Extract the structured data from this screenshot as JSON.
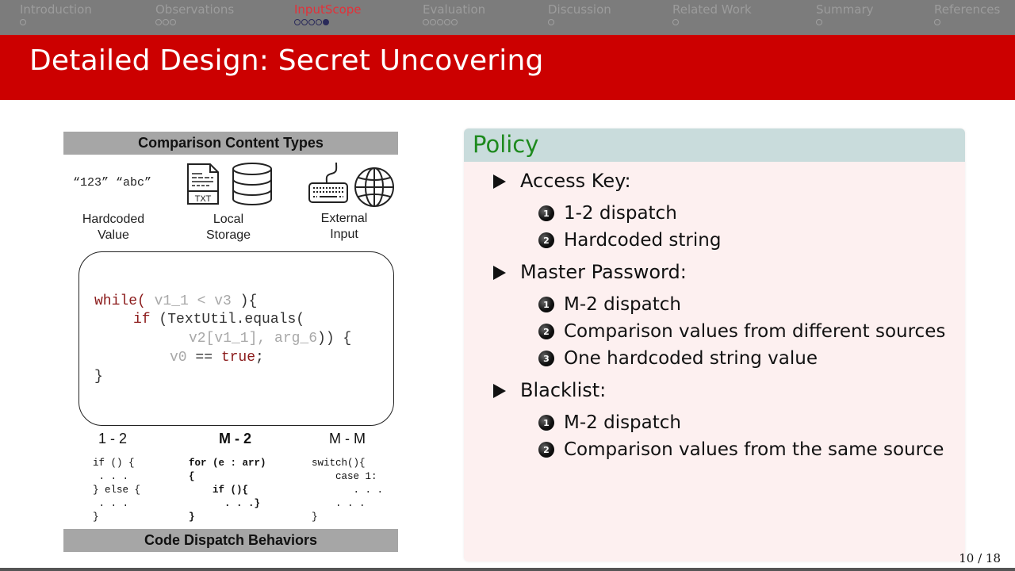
{
  "nav": {
    "sections": [
      {
        "label": "Introduction",
        "dots": 1,
        "filled": 0,
        "active": false
      },
      {
        "label": "Observations",
        "dots": 3,
        "filled": 0,
        "active": false
      },
      {
        "label": "InputScope",
        "dots": 5,
        "filled": 5,
        "active": true
      },
      {
        "label": "Evaluation",
        "dots": 5,
        "filled": 0,
        "active": false
      },
      {
        "label": "Discussion",
        "dots": 1,
        "filled": 0,
        "active": false
      },
      {
        "label": "Related Work",
        "dots": 1,
        "filled": 0,
        "active": false
      },
      {
        "label": "Summary",
        "dots": 1,
        "filled": 0,
        "active": false
      },
      {
        "label": "References",
        "dots": 1,
        "filled": 0,
        "active": false
      }
    ]
  },
  "slide": {
    "title": "Detailed Design: Secret Uncovering",
    "page": "10 / 18"
  },
  "figure": {
    "header": "Comparison Content Types",
    "footer": "Code Dispatch Behaviors",
    "hardcoded_sample": "“123” “abc”",
    "types": [
      {
        "line1": "Hardcoded",
        "line2": "Value",
        "icons": []
      },
      {
        "line1": "Local",
        "line2": "Storage",
        "icons": [
          "txt-file-icon",
          "database-icon"
        ]
      },
      {
        "line1": "External",
        "line2": "Input",
        "icons": [
          "keyboard-icon",
          "globe-icon"
        ]
      }
    ],
    "txt_label": "TXT",
    "code": {
      "l1_kw": "while(",
      "l1_var": " v1_1 < v3 ",
      "l1_end": "){",
      "l2_kw": "if",
      "l2_rest": " (TextUtil.equals(",
      "l3_var1": "v2[v1_1], arg_6",
      "l3_end": ")) {",
      "l4_var": "v0",
      "l4_mid": " == ",
      "l4_kw": "true",
      "l4_end": ";",
      "l5": "}"
    },
    "dispatch": [
      {
        "label": "1 - 2",
        "code": "if () {\n . . .\n} else {\n . . .\n}"
      },
      {
        "label": "M - 2",
        "code": "for (e : arr)\n{\n    if (){\n      . . .}\n}"
      },
      {
        "label": "M - M",
        "code": "switch(){\n    case 1:\n       . . .\n    . . .\n}"
      }
    ]
  },
  "policy": {
    "title": "Policy",
    "groups": [
      {
        "label": "Access Key:",
        "items": [
          "1-2 dispatch",
          "Hardcoded string"
        ]
      },
      {
        "label": "Master Password:",
        "items": [
          "M-2 dispatch",
          "Comparison values from different sources",
          "One hardcoded string value"
        ]
      },
      {
        "label": "Blacklist:",
        "items": [
          "M-2 dispatch",
          "Comparison values from the same source"
        ]
      }
    ],
    "numbers": [
      "1",
      "2",
      "3"
    ]
  }
}
